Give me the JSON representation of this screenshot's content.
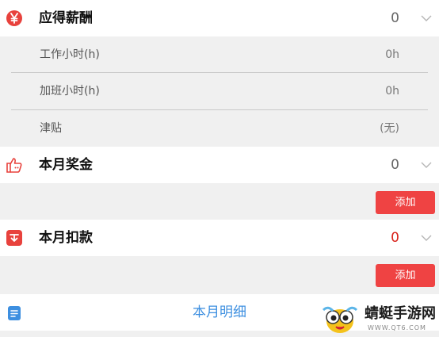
{
  "salary": {
    "icon": "yen-icon",
    "title": "应得薪酬",
    "value": "0",
    "rows": [
      {
        "label": "工作小时(h)",
        "value": "0h"
      },
      {
        "label": "加班小时(h)",
        "value": "0h"
      },
      {
        "label": "津贴",
        "value": "(无)"
      }
    ]
  },
  "bonus": {
    "icon": "thumbs-up-icon",
    "title": "本月奖金",
    "value": "0",
    "add_label": "添加"
  },
  "deduction": {
    "icon": "deduction-icon",
    "title": "本月扣款",
    "value": "0",
    "add_label": "添加"
  },
  "details": {
    "icon": "document-icon",
    "label": "本月明细"
  },
  "watermark": {
    "text": "蜻蜓手游网",
    "url": "WWW.QT6.COM"
  },
  "colors": {
    "accent_red": "#ef4343",
    "value_red": "#d9231b",
    "link_blue": "#3d8fe0"
  }
}
